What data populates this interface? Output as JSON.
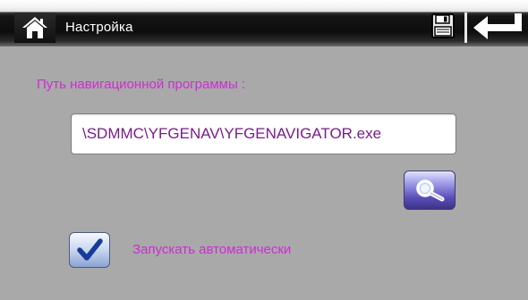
{
  "header": {
    "title": "Настройка",
    "home_icon": "home-icon",
    "save_icon": "floppy-disk-icon",
    "back_icon": "return-arrow-icon"
  },
  "navigation_program": {
    "label": "Путь навигационной программы :",
    "path_value": "\\SDMMC\\YFGENAV\\YFGENAVIGATOR.exe",
    "browse_icon": "magnifier-icon"
  },
  "autostart": {
    "label": "Запускать автоматически",
    "checked": true
  },
  "colors": {
    "background": "#a9a9a9",
    "label_text": "#d02bd6",
    "value_text": "#7a1b8e",
    "browse_button": "#5a4fb8"
  }
}
